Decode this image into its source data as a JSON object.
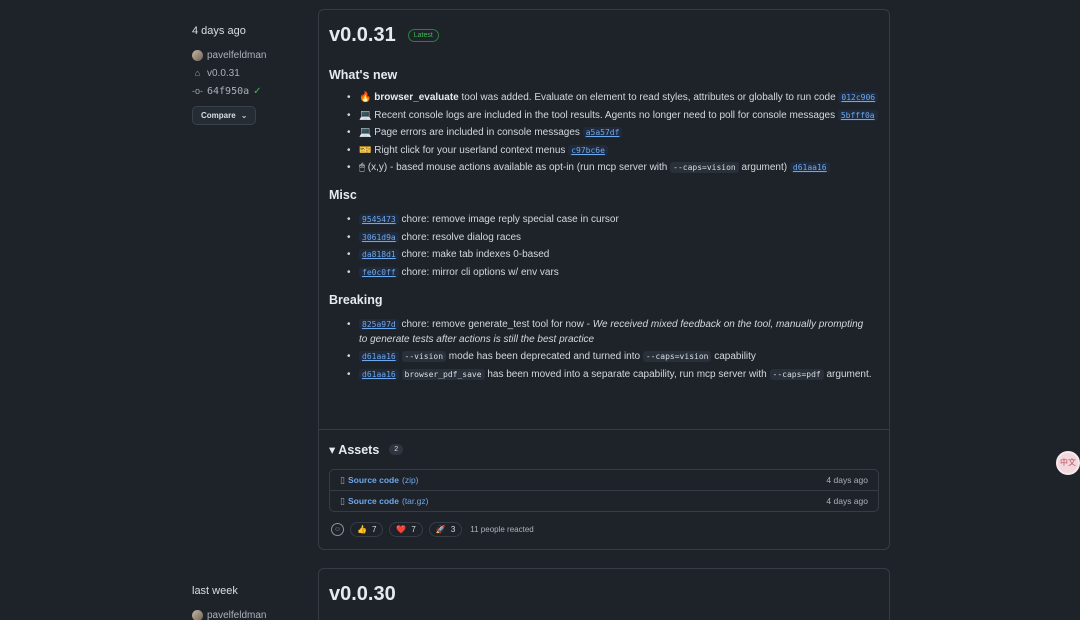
{
  "releases": [
    {
      "when": "4 days ago",
      "author": "pavelfeldman",
      "tag": "v0.0.31",
      "commit": "64f950a",
      "compare_label": "Compare",
      "title": "v0.0.31",
      "badge": "Latest"
    },
    {
      "when": "last week",
      "author": "pavelfeldman",
      "title": "v0.0.30"
    }
  ],
  "sections": {
    "whats_new": "What's new",
    "misc": "Misc",
    "breaking": "Breaking"
  },
  "whats_new_items": [
    {
      "emoji": "🔥",
      "bold": "browser_evaluate",
      "text": " tool was added. Evaluate on element to read styles, attributes or globally to run code ",
      "sha": "012c906"
    },
    {
      "emoji": "💻",
      "text": "Recent console logs are included in the tool results. Agents no longer need to poll for console messages ",
      "sha": "5bfff0a"
    },
    {
      "emoji": "💻",
      "text": "Page errors are included in console messages ",
      "sha": "a5a57df"
    },
    {
      "emoji": "🎫",
      "text": "Right click for your userland context menus ",
      "sha": "c97bc6e"
    },
    {
      "emoji": "🖱",
      "text_pre": "(x,y) - based mouse actions available as opt-in (run mcp server with ",
      "code": "--caps=vision",
      "text_post": " argument) ",
      "sha": "d61aa16"
    }
  ],
  "misc_items": [
    {
      "sha": "9545473",
      "text": " chore: remove image reply special case in cursor"
    },
    {
      "sha": "3061d9a",
      "text": " chore: resolve dialog races"
    },
    {
      "sha": "da818d1",
      "text": " chore: make tab indexes 0-based"
    },
    {
      "sha": "fe0c0ff",
      "text": " chore: mirror cli options w/ env vars"
    }
  ],
  "breaking_items": [
    {
      "sha": "825a97d",
      "text": " chore: remove generate_test tool for now - ",
      "italic": "We received mixed feedback on the tool, manually prompting to generate tests after actions is still the best practice"
    },
    {
      "sha": "d61aa16",
      "code1": "--vision",
      "mid": " mode has been deprecated and turned into ",
      "code2": "--caps=vision",
      "end": " capability"
    },
    {
      "sha": "d61aa16",
      "code1": "browser_pdf_save",
      "mid": " has been moved into a separate capability, run mcp server with ",
      "code2": "--caps=pdf",
      "end": " argument."
    }
  ],
  "assets": {
    "label": "Assets",
    "count": "2",
    "items": [
      {
        "name": "Source code",
        "ext": "(zip)",
        "date": "4 days ago"
      },
      {
        "name": "Source code",
        "ext": "(tar.gz)",
        "date": "4 days ago"
      }
    ]
  },
  "reactions": {
    "items": [
      {
        "emoji": "👍",
        "count": "7"
      },
      {
        "emoji": "❤️",
        "count": "7"
      },
      {
        "emoji": "🚀",
        "count": "3"
      }
    ],
    "summary": "11 people reacted"
  },
  "float_button": "中文"
}
